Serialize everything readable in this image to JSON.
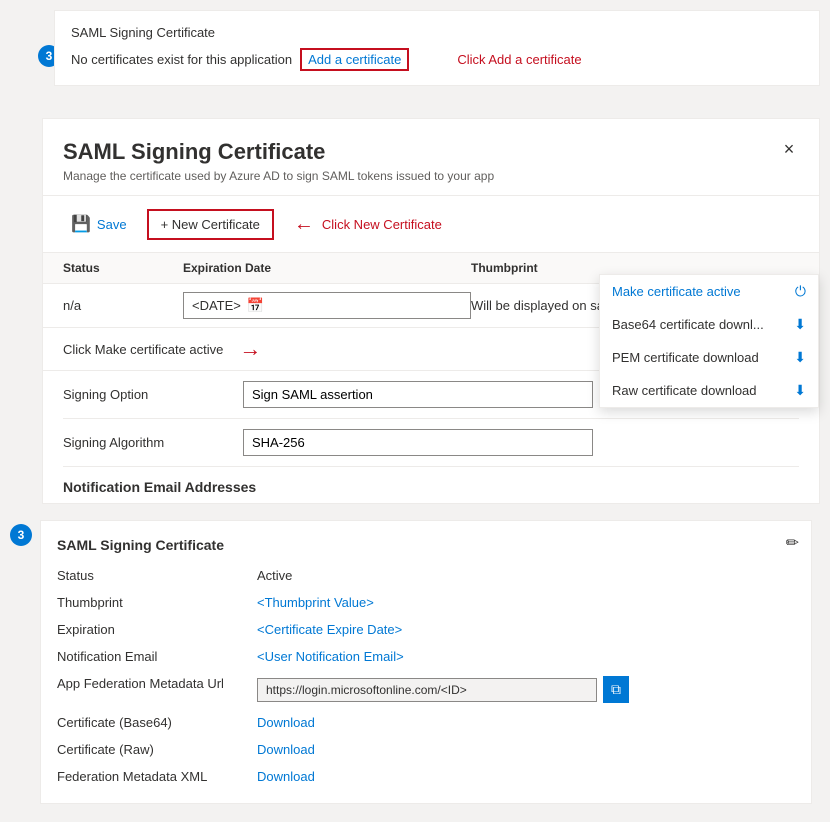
{
  "step1": {
    "number": "3",
    "title": "SAML Signing Certificate",
    "no_cert_text": "No certificates exist for this application",
    "add_cert_link": "Add a certificate",
    "click_instruction": "Click Add a certificate"
  },
  "panel": {
    "title": "SAML Signing Certificate",
    "subtitle": "Manage the certificate used by Azure AD to sign SAML tokens issued to your app",
    "close_label": "×"
  },
  "toolbar": {
    "save_label": "Save",
    "new_cert_label": "+ New Certificate",
    "click_instruction": "Click New Certificate"
  },
  "table": {
    "headers": {
      "status": "Status",
      "expiration": "Expiration Date",
      "thumbprint": "Thumbprint",
      "actions": ""
    },
    "row": {
      "status": "n/a",
      "date": "<DATE>",
      "thumbprint": "Will be displayed on save",
      "more": "···"
    }
  },
  "instruction": {
    "text": "Click Make certificate active",
    "arrow": "→"
  },
  "dropdown": {
    "make_active": "Make certificate active",
    "base64": "Base64 certificate downl...",
    "pem": "PEM certificate download",
    "raw": "Raw certificate download"
  },
  "form": {
    "signing_option_label": "Signing Option",
    "signing_option_value": "Sign SAML assertion",
    "signing_algorithm_label": "Signing Algorithm",
    "signing_algorithm_value": "SHA-256"
  },
  "notification": {
    "section_title": "Notification Email Addresses"
  },
  "info_box": {
    "title": "SAML Signing Certificate",
    "status_label": "Status",
    "status_value": "Active",
    "thumbprint_label": "Thumbprint",
    "thumbprint_value": "<Thumbprint Value>",
    "expiration_label": "Expiration",
    "expiration_value": "<Certificate Expire Date>",
    "email_label": "Notification Email",
    "email_value": "<User Notification Email>",
    "url_label": "App Federation Metadata Url",
    "url_value": "https://login.microsoftonline.com/<ID>",
    "cert_base64_label": "Certificate (Base64)",
    "cert_base64_link": "Download",
    "cert_raw_label": "Certificate (Raw)",
    "cert_raw_link": "Download",
    "fed_metadata_label": "Federation Metadata XML",
    "fed_metadata_link": "Download"
  }
}
